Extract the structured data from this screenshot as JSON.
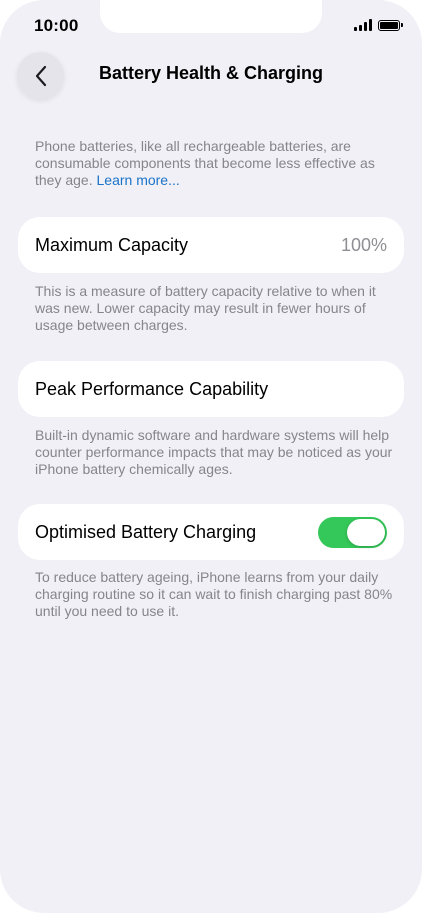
{
  "status_bar": {
    "time": "10:00",
    "signal_icon": "cellular-signal-icon",
    "battery_icon": "battery-full-icon"
  },
  "nav": {
    "back_icon": "chevron-left-icon",
    "title": "Battery Health & Charging"
  },
  "intro": {
    "text": "Phone batteries, like all rechargeable batteries, are consumable components that become less effective as they age. ",
    "link_label": "Learn more..."
  },
  "maximum_capacity": {
    "label": "Maximum Capacity",
    "value": "100%",
    "description": "This is a measure of battery capacity relative to when it was new. Lower capacity may result in fewer hours of usage between charges."
  },
  "peak_performance": {
    "label": "Peak Performance Capability",
    "description": "Built-in dynamic software and hardware systems will help counter performance impacts that may be noticed as your iPhone battery chemically ages."
  },
  "optimised_charging": {
    "label": "Optimised Battery Charging",
    "enabled": true,
    "description": "To reduce battery ageing, iPhone learns from your daily charging routine so it can wait to finish charging past 80% until you need to use it."
  },
  "colors": {
    "background": "#f0f0f6",
    "card": "#ffffff",
    "secondary_text": "#85858b",
    "link": "#1a73c8",
    "toggle_on": "#34c759"
  }
}
